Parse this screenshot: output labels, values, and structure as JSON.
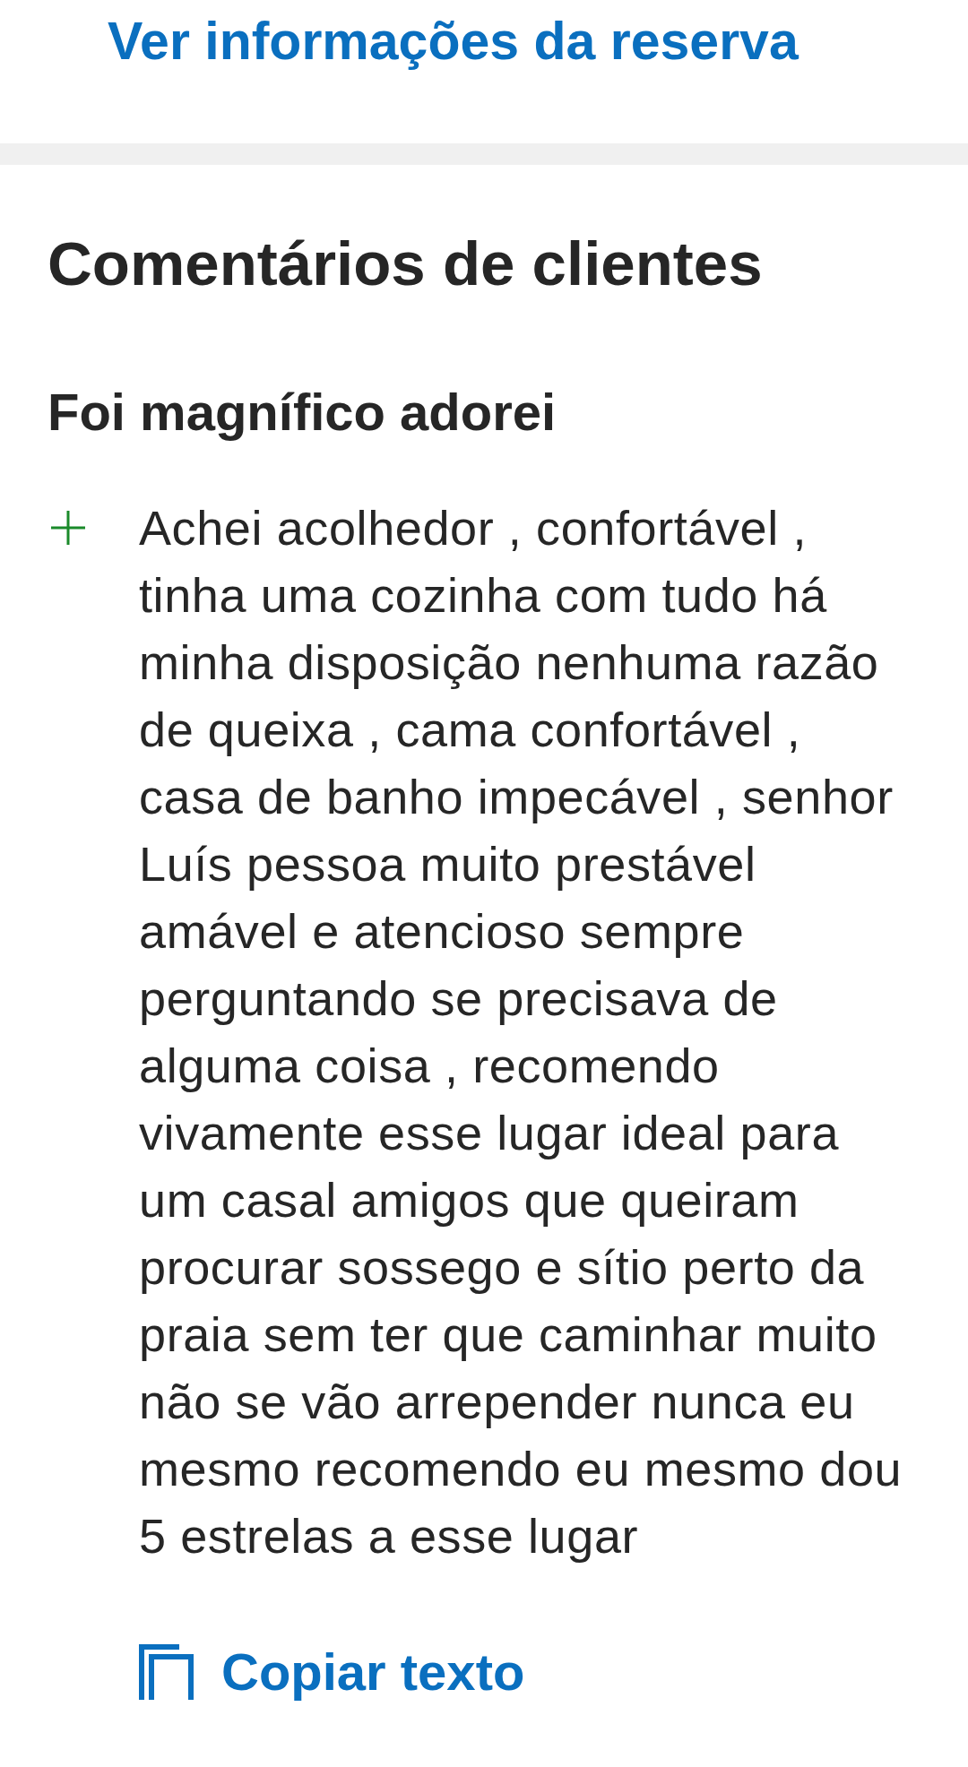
{
  "reservation_link": "Ver informações da reserva",
  "section": {
    "title": "Comentários de clientes"
  },
  "review": {
    "title": "Foi magnífico adorei",
    "comments": [
      {
        "kind": "positive",
        "text": "Achei acolhedor , confortável , tinha uma cozinha com tudo há minha disposição nenhuma razão de queixa , cama confortável , casa de banho impecável , senhor Luís pessoa muito prestável amável e atencioso sempre perguntando se precisava de alguma coisa , recomendo vivamente esse lugar ideal para um casal amigos que queiram procurar sossego e sítio perto da praia sem ter que caminhar muito não se vão arrepender nunca eu mesmo recomendo eu mesmo dou 5 estrelas a esse lugar"
      }
    ],
    "copy_button": "Copiar texto"
  }
}
